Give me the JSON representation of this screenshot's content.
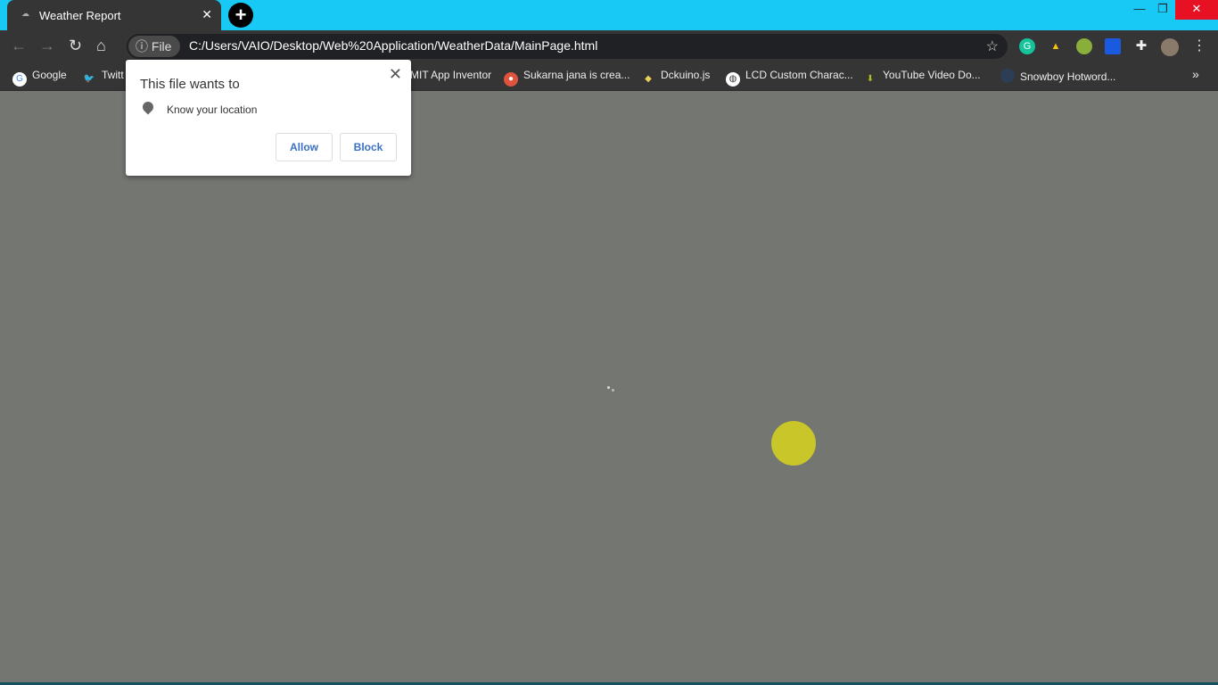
{
  "tab": {
    "title": "Weather Report",
    "close": "✕",
    "new_tab": "+"
  },
  "window": {
    "minimize": "—",
    "restore": "❐",
    "close": "✕"
  },
  "omnibox": {
    "chip": "File",
    "url": "C:/Users/VAIO/Desktop/Web%20Application/WeatherData/MainPage.html"
  },
  "bookmarks": [
    {
      "label": "Google",
      "icon": "G",
      "color": "#ffffff"
    },
    {
      "label": "Twitt",
      "icon": "t",
      "color": "#1da1f2"
    },
    {
      "label": "MIT App Inventor",
      "icon": "",
      "color": "#353535"
    },
    {
      "label": "Sukarna jana is crea...",
      "icon": "●",
      "color": "#e0533c"
    },
    {
      "label": "Dckuino.js",
      "icon": "◆",
      "color": "#e8d25a"
    },
    {
      "label": "LCD Custom Charac...",
      "icon": "◍",
      "color": "#ffffff"
    },
    {
      "label": "YouTube Video Do...",
      "icon": "↓",
      "color": "#b8b820"
    },
    {
      "label": "Snowboy Hotword...",
      "icon": "●",
      "color": "#2c3e55"
    }
  ],
  "popup": {
    "heading": "This file wants to",
    "permission": "Know your location",
    "allow": "Allow",
    "block": "Block",
    "close": "✕"
  },
  "colors": {
    "accent": "#18c8f5",
    "page_bg": "#747672",
    "sun": "#c9c62a"
  }
}
